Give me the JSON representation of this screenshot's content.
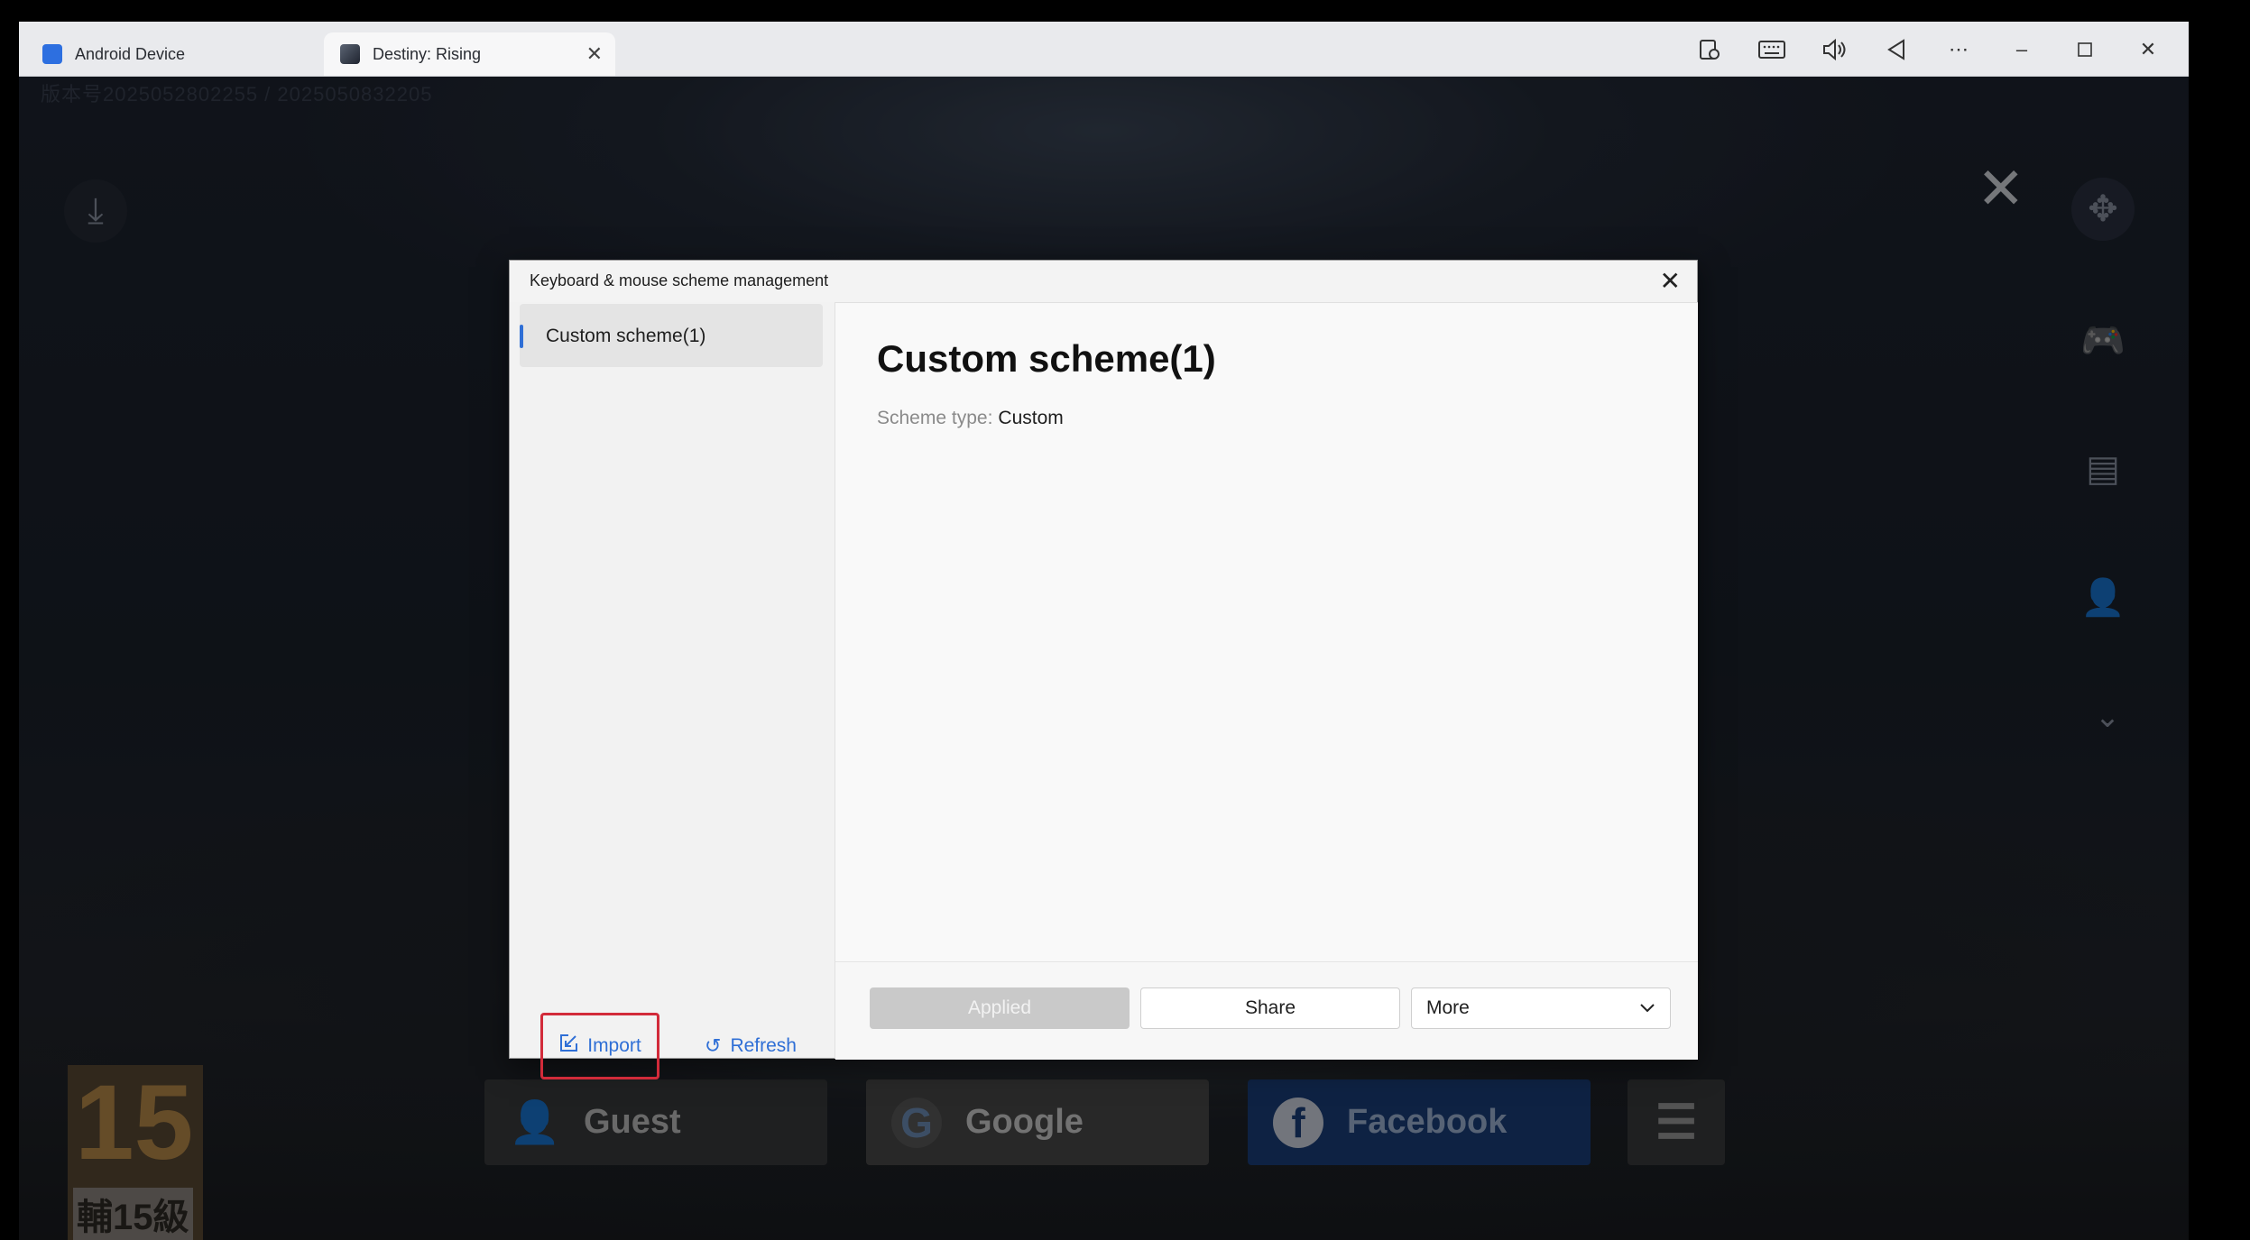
{
  "tabs": [
    {
      "label": "Android Device"
    },
    {
      "label": "Destiny: Rising"
    }
  ],
  "system_buttons": [
    "screenshot-icon",
    "keyboard-icon",
    "volume-icon",
    "back-icon",
    "more-icon",
    "minimize-icon",
    "maximize-icon",
    "close-icon"
  ],
  "game": {
    "build_text": "版本号2025052802255 / 2025050832205",
    "login_buttons": [
      {
        "label": "Guest"
      },
      {
        "label": "Google"
      },
      {
        "label": "Facebook"
      }
    ],
    "rating": {
      "age": "15",
      "text": "輔15級"
    }
  },
  "dialog": {
    "title": "Keyboard & mouse scheme management",
    "schemes": [
      {
        "label": "Custom scheme(1)"
      }
    ],
    "import_label": "Import",
    "refresh_label": "Refresh",
    "selected": {
      "title": "Custom scheme(1)",
      "type_key": "Scheme type:",
      "type_value": "Custom"
    },
    "applied_label": "Applied",
    "share_label": "Share",
    "more_label": "More"
  },
  "colors": {
    "accent": "#2f6fd6",
    "highlight_border": "#d22b3a",
    "facebook": "#1b4f9e"
  }
}
